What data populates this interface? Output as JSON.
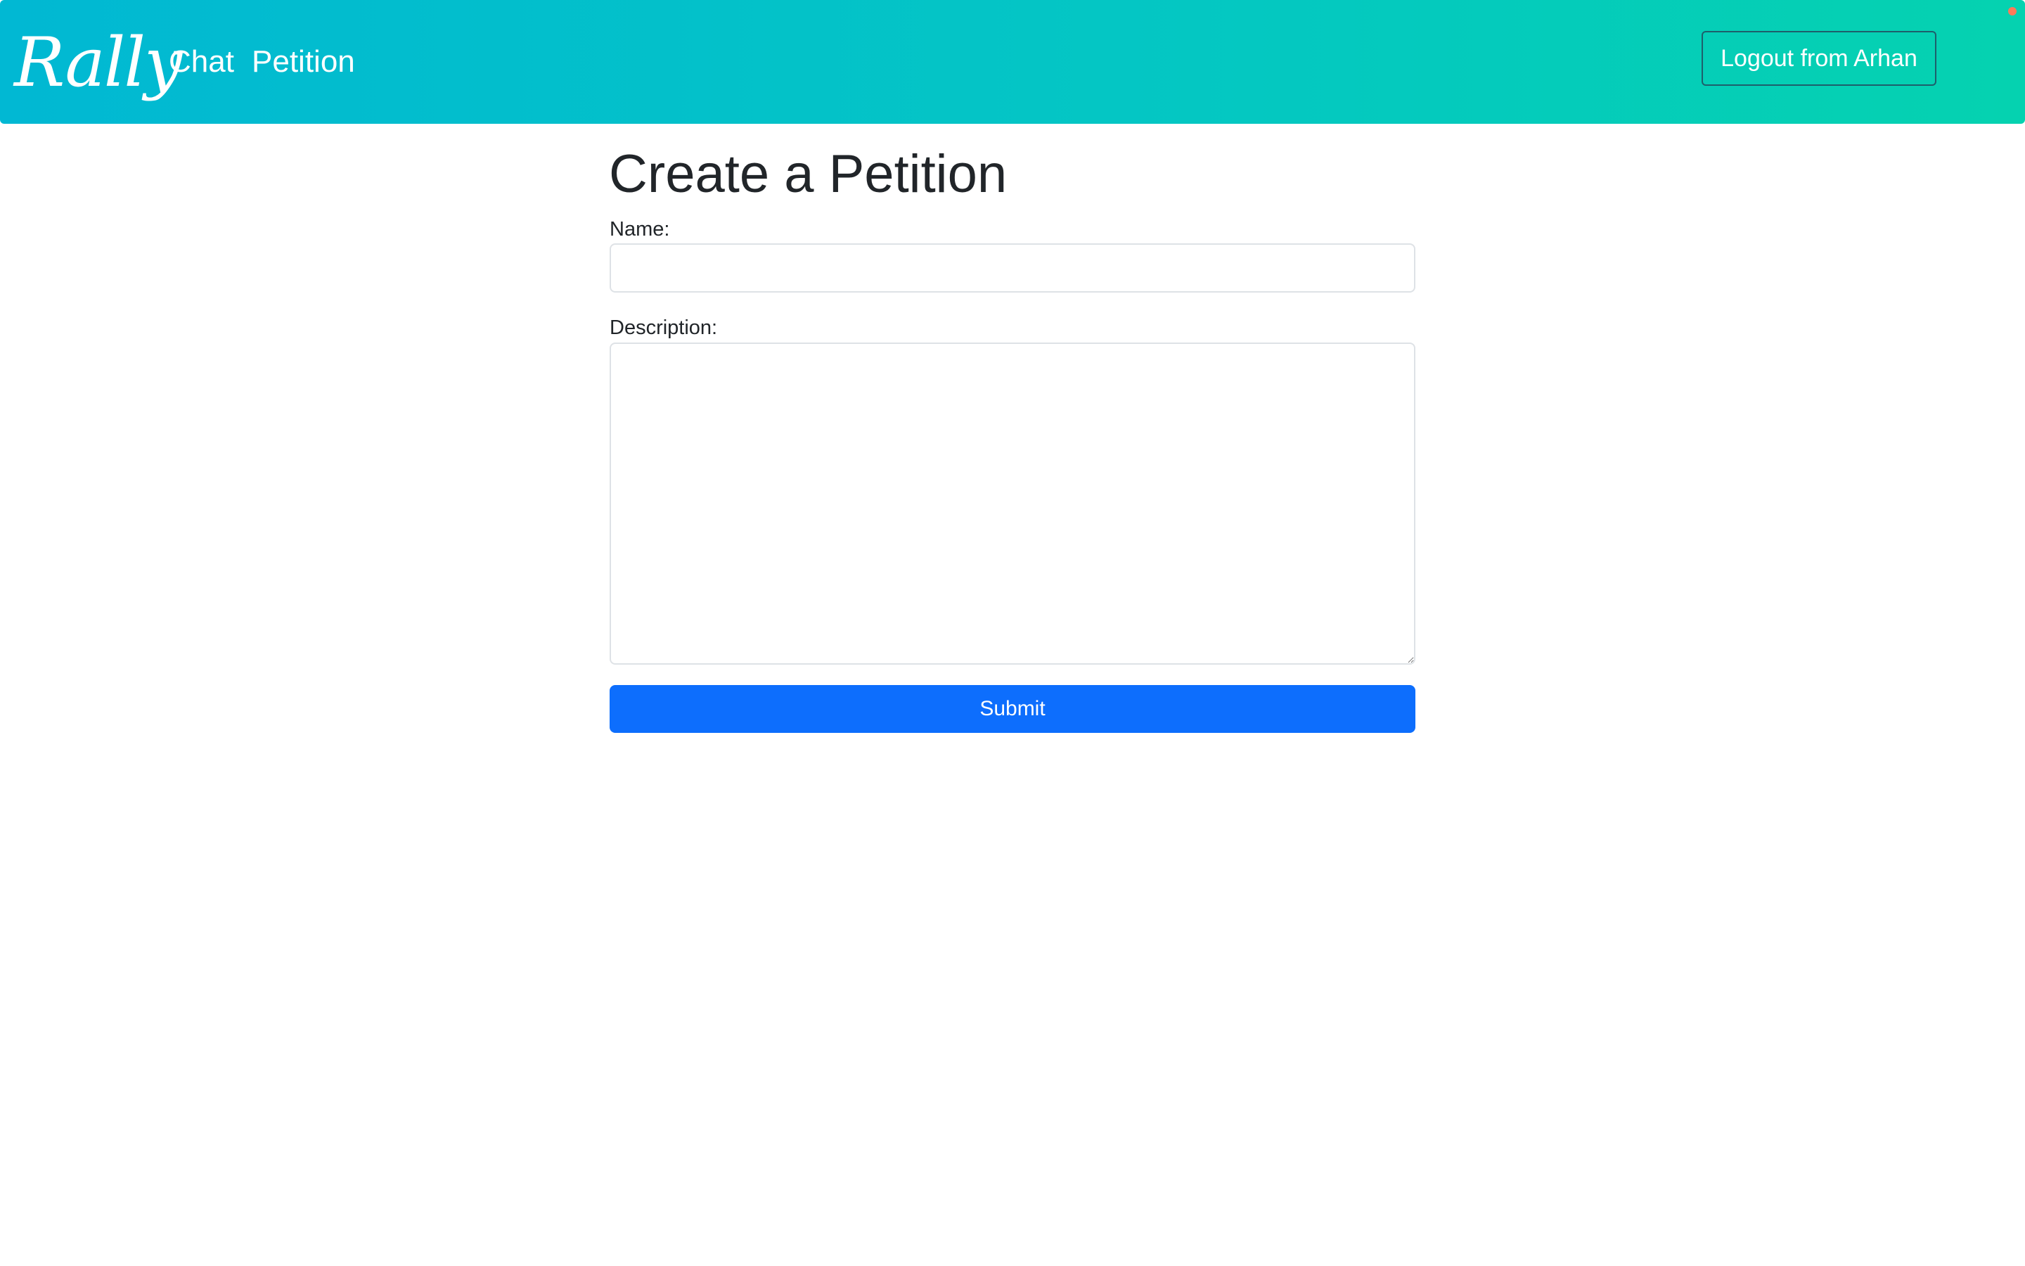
{
  "navbar": {
    "brand": "Rally",
    "links": [
      {
        "label": "Chat"
      },
      {
        "label": "Petition"
      }
    ],
    "logout_label": "Logout from Arhan",
    "gradient_start": "#01b8d3",
    "gradient_end": "#05d2b0"
  },
  "form": {
    "title": "Create a Petition",
    "name_label": "Name:",
    "name_value": "",
    "description_label": "Description:",
    "description_value": "",
    "submit_label": "Submit",
    "submit_color": "#0d6efd"
  }
}
